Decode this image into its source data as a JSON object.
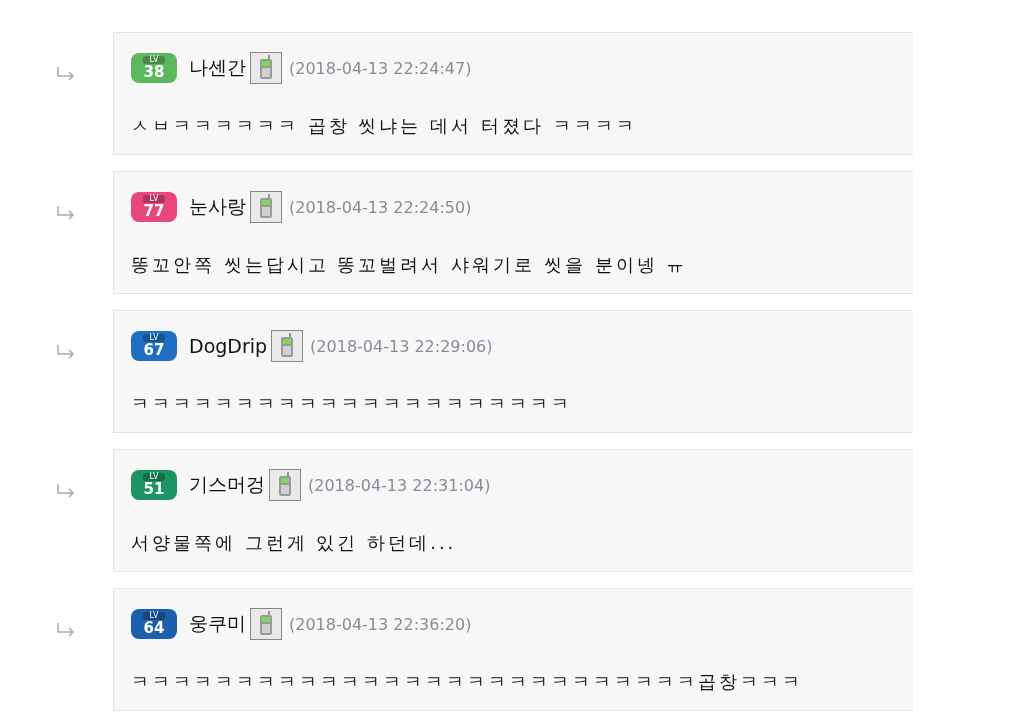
{
  "comments": [
    {
      "level_badge": {
        "caption": "LV",
        "number": "38",
        "color": "#5cb85c"
      },
      "author": "나센간",
      "time": "(2018-04-13 22:24:47)",
      "body": "ㅅㅂㅋㅋㅋㅋㅋㅋ 곱창 씻냐는 데서 터졌다 ㅋㅋㅋㅋ"
    },
    {
      "level_badge": {
        "caption": "LV",
        "number": "77",
        "color": "#e8467c"
      },
      "author": "눈사랑",
      "time": "(2018-04-13 22:24:50)",
      "body": "똥꼬안쪽 씻는답시고 똥꼬벌려서 샤워기로 씻을 분이넹 ㅠ"
    },
    {
      "level_badge": {
        "caption": "LV",
        "number": "67",
        "color": "#1f6fc0"
      },
      "author": "DogDrip",
      "time": "(2018-04-13 22:29:06)",
      "body": "ㅋㅋㅋㅋㅋㅋㅋㅋㅋㅋㅋㅋㅋㅋㅋㅋㅋㅋㅋㅋㅋ"
    },
    {
      "level_badge": {
        "caption": "LV",
        "number": "51",
        "color": "#1e9464"
      },
      "author": "기스머겅",
      "time": "(2018-04-13 22:31:04)",
      "body": "서양물쪽에 그런게 있긴 하던데..."
    },
    {
      "level_badge": {
        "caption": "LV",
        "number": "64",
        "color": "#1c5fae"
      },
      "author": "웅쿠미",
      "time": "(2018-04-13 22:36:20)",
      "body": "ㅋㅋㅋㅋㅋㅋㅋㅋㅋㅋㅋㅋㅋㅋㅋㅋㅋㅋㅋㅋㅋㅋㅋㅋㅋㅋㅋ곱창ㅋㅋㅋ"
    }
  ]
}
